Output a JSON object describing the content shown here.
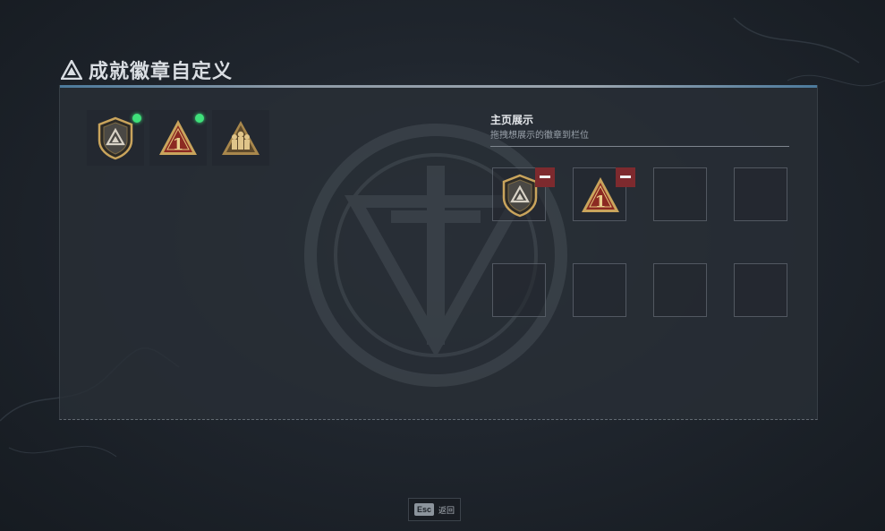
{
  "header": {
    "title": "成就徽章自定义",
    "icon": "delta-triangle-icon"
  },
  "inventory": {
    "badges": [
      {
        "id": "shield-delta",
        "icon": "shield-badge-icon",
        "new": true
      },
      {
        "id": "rank-one",
        "icon": "rank-one-badge-icon",
        "new": true
      },
      {
        "id": "squad",
        "icon": "squad-badge-icon",
        "new": false
      }
    ]
  },
  "showcase": {
    "title": "主页展示",
    "subtitle": "拖拽想展示的徽章到栏位",
    "slots": [
      {
        "badge": "shield-delta"
      },
      {
        "badge": "rank-one"
      },
      {
        "badge": null
      },
      {
        "badge": null
      },
      {
        "badge": null
      },
      {
        "badge": null
      },
      {
        "badge": null
      },
      {
        "badge": null
      }
    ]
  },
  "footer": {
    "esc_key": "Esc",
    "esc_label": "返回"
  },
  "colors": {
    "accent_green": "#3fe07a",
    "remove_red": "#7d2a2e",
    "badge_gold": "#c9a45c"
  }
}
